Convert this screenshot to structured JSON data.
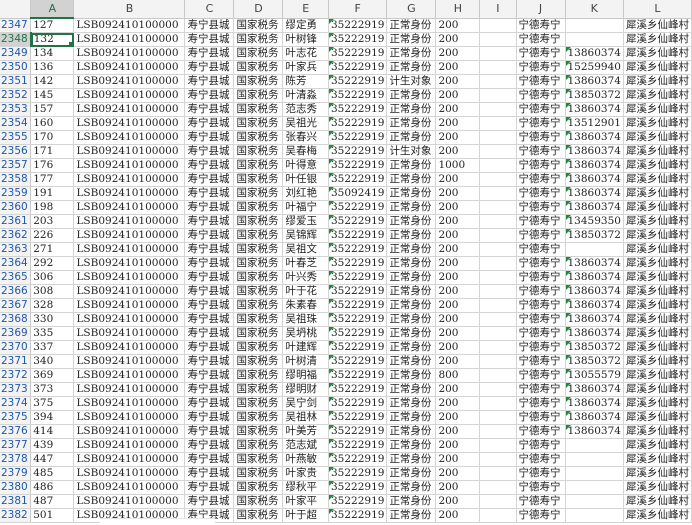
{
  "columns": [
    "A",
    "B",
    "C",
    "D",
    "E",
    "F",
    "G",
    "H",
    "I",
    "J",
    "K",
    "L"
  ],
  "selected_column": "A",
  "selected_row": "2348",
  "rows": [
    {
      "n": "2347",
      "cells": [
        "127",
        "LSB092410100000",
        "寿宁县城",
        "国家税务",
        "缪定勇",
        "35222919",
        "正常身份",
        "200",
        "",
        "宁德寿宁",
        "",
        "犀溪乡仙峰村"
      ]
    },
    {
      "n": "2348",
      "cells": [
        "132",
        "LSB092410100000",
        "寿宁县城",
        "国家税务",
        "叶树锋",
        "35222919",
        "正常身份",
        "200",
        "",
        "宁德寿宁",
        "",
        "犀溪乡仙峰村"
      ]
    },
    {
      "n": "2349",
      "cells": [
        "134",
        "LSB092410100000",
        "寿宁县城",
        "国家税务",
        "叶志花",
        "35222919",
        "正常身份",
        "200",
        "",
        "宁德寿宁",
        "13860374",
        "犀溪乡仙峰村"
      ]
    },
    {
      "n": "2350",
      "cells": [
        "136",
        "LSB092410100000",
        "寿宁县城",
        "国家税务",
        "叶家兵",
        "35222919",
        "正常身份",
        "200",
        "",
        "宁德寿宁",
        "15259940",
        "犀溪乡仙峰村"
      ]
    },
    {
      "n": "2351",
      "cells": [
        "142",
        "LSB092410100000",
        "寿宁县城",
        "国家税务",
        "陈芳",
        "35222919",
        "计生对象",
        "200",
        "",
        "宁德寿宁",
        "13860374",
        "犀溪乡仙峰村"
      ]
    },
    {
      "n": "2352",
      "cells": [
        "145",
        "LSB092410100000",
        "寿宁县城",
        "国家税务",
        "叶清淼",
        "35222919",
        "正常身份",
        "200",
        "",
        "宁德寿宁",
        "13850372",
        "犀溪乡仙峰村"
      ]
    },
    {
      "n": "2353",
      "cells": [
        "157",
        "LSB092410100000",
        "寿宁县城",
        "国家税务",
        "范志秀",
        "35222919",
        "正常身份",
        "200",
        "",
        "宁德寿宁",
        "13860374",
        "犀溪乡仙峰村"
      ]
    },
    {
      "n": "2354",
      "cells": [
        "160",
        "LSB092410100000",
        "寿宁县城",
        "国家税务",
        "吴祖光",
        "35222919",
        "正常身份",
        "200",
        "",
        "宁德寿宁",
        "13512901",
        "犀溪乡仙峰村"
      ]
    },
    {
      "n": "2355",
      "cells": [
        "170",
        "LSB092410100000",
        "寿宁县城",
        "国家税务",
        "张春兴",
        "35222919",
        "正常身份",
        "200",
        "",
        "宁德寿宁",
        "13860374",
        "犀溪乡仙峰村"
      ]
    },
    {
      "n": "2356",
      "cells": [
        "171",
        "LSB092410100000",
        "寿宁县城",
        "国家税务",
        "吴春梅",
        "35222919",
        "计生对象",
        "200",
        "",
        "宁德寿宁",
        "13860374",
        "犀溪乡仙峰村"
      ]
    },
    {
      "n": "2357",
      "cells": [
        "176",
        "LSB092410100000",
        "寿宁县城",
        "国家税务",
        "叶得意",
        "35222919",
        "正常身份",
        "1000",
        "",
        "宁德寿宁",
        "13860374",
        "犀溪乡仙峰村"
      ]
    },
    {
      "n": "2358",
      "cells": [
        "177",
        "LSB092410100000",
        "寿宁县城",
        "国家税务",
        "叶任银",
        "35222919",
        "正常身份",
        "200",
        "",
        "宁德寿宁",
        "13860374",
        "犀溪乡仙峰村"
      ]
    },
    {
      "n": "2359",
      "cells": [
        "191",
        "LSB092410100000",
        "寿宁县城",
        "国家税务",
        "刘红艳",
        "35092419",
        "正常身份",
        "200",
        "",
        "宁德寿宁",
        "13860374",
        "犀溪乡仙峰村"
      ]
    },
    {
      "n": "2360",
      "cells": [
        "198",
        "LSB092410100000",
        "寿宁县城",
        "国家税务",
        "叶福宁",
        "35222919",
        "正常身份",
        "200",
        "",
        "宁德寿宁",
        "13860374",
        "犀溪乡仙峰村"
      ]
    },
    {
      "n": "2361",
      "cells": [
        "203",
        "LSB092410100000",
        "寿宁县城",
        "国家税务",
        "缪爱玉",
        "35222919",
        "正常身份",
        "200",
        "",
        "宁德寿宁",
        "13459350",
        "犀溪乡仙峰村"
      ]
    },
    {
      "n": "2362",
      "cells": [
        "226",
        "LSB092410100000",
        "寿宁县城",
        "国家税务",
        "吴锦辉",
        "35222919",
        "正常身份",
        "200",
        "",
        "宁德寿宁",
        "13850372",
        "犀溪乡仙峰村"
      ]
    },
    {
      "n": "2363",
      "cells": [
        "271",
        "LSB092410100000",
        "寿宁县城",
        "国家税务",
        "吴祖文",
        "35222919",
        "正常身份",
        "200",
        "",
        "宁德寿宁",
        "",
        "犀溪乡仙峰村"
      ]
    },
    {
      "n": "2364",
      "cells": [
        "292",
        "LSB092410100000",
        "寿宁县城",
        "国家税务",
        "叶春芝",
        "35222919",
        "正常身份",
        "200",
        "",
        "宁德寿宁",
        "13860374",
        "犀溪乡仙峰村"
      ]
    },
    {
      "n": "2365",
      "cells": [
        "306",
        "LSB092410100000",
        "寿宁县城",
        "国家税务",
        "叶兴秀",
        "35222919",
        "正常身份",
        "200",
        "",
        "宁德寿宁",
        "13860374",
        "犀溪乡仙峰村"
      ]
    },
    {
      "n": "2366",
      "cells": [
        "308",
        "LSB092410100000",
        "寿宁县城",
        "国家税务",
        "叶于花",
        "35222919",
        "正常身份",
        "200",
        "",
        "宁德寿宁",
        "13860374",
        "犀溪乡仙峰村"
      ]
    },
    {
      "n": "2367",
      "cells": [
        "328",
        "LSB092410100000",
        "寿宁县城",
        "国家税务",
        "朱素春",
        "35222919",
        "正常身份",
        "200",
        "",
        "宁德寿宁",
        "13860374",
        "犀溪乡仙峰村"
      ]
    },
    {
      "n": "2368",
      "cells": [
        "330",
        "LSB092410100000",
        "寿宁县城",
        "国家税务",
        "吴祖珠",
        "35222919",
        "正常身份",
        "200",
        "",
        "宁德寿宁",
        "13860374",
        "犀溪乡仙峰村"
      ]
    },
    {
      "n": "2369",
      "cells": [
        "335",
        "LSB092410100000",
        "寿宁县城",
        "国家税务",
        "吴坍桃",
        "35222919",
        "正常身份",
        "200",
        "",
        "宁德寿宁",
        "13860374",
        "犀溪乡仙峰村"
      ]
    },
    {
      "n": "2370",
      "cells": [
        "337",
        "LSB092410100000",
        "寿宁县城",
        "国家税务",
        "叶建辉",
        "35222919",
        "正常身份",
        "200",
        "",
        "宁德寿宁",
        "13850372",
        "犀溪乡仙峰村"
      ]
    },
    {
      "n": "2371",
      "cells": [
        "340",
        "LSB092410100000",
        "寿宁县城",
        "国家税务",
        "叶树清",
        "35222919",
        "正常身份",
        "200",
        "",
        "宁德寿宁",
        "13850372",
        "犀溪乡仙峰村"
      ]
    },
    {
      "n": "2372",
      "cells": [
        "369",
        "LSB092410100000",
        "寿宁县城",
        "国家税务",
        "缪明福",
        "35222919",
        "正常身份",
        "800",
        "",
        "宁德寿宁",
        "13055579",
        "犀溪乡仙峰村"
      ]
    },
    {
      "n": "2373",
      "cells": [
        "373",
        "LSB092410100000",
        "寿宁县城",
        "国家税务",
        "缪明财",
        "35222919",
        "正常身份",
        "200",
        "",
        "宁德寿宁",
        "13860374",
        "犀溪乡仙峰村"
      ]
    },
    {
      "n": "2374",
      "cells": [
        "375",
        "LSB092410100000",
        "寿宁县城",
        "国家税务",
        "吴宁剑",
        "35222919",
        "正常身份",
        "200",
        "",
        "宁德寿宁",
        "13860374",
        "犀溪乡仙峰村"
      ]
    },
    {
      "n": "2375",
      "cells": [
        "394",
        "LSB092410100000",
        "寿宁县城",
        "国家税务",
        "吴祖林",
        "35222919",
        "正常身份",
        "200",
        "",
        "宁德寿宁",
        "13860374",
        "犀溪乡仙峰村"
      ]
    },
    {
      "n": "2376",
      "cells": [
        "414",
        "LSB092410100000",
        "寿宁县城",
        "国家税务",
        "叶美芳",
        "35222919",
        "正常身份",
        "200",
        "",
        "宁德寿宁",
        "13860374",
        "犀溪乡仙峰村"
      ]
    },
    {
      "n": "2377",
      "cells": [
        "439",
        "LSB092410100000",
        "寿宁县城",
        "国家税务",
        "范志斌",
        "35222919",
        "正常身份",
        "200",
        "",
        "宁德寿宁",
        "",
        "犀溪乡仙峰村"
      ]
    },
    {
      "n": "2378",
      "cells": [
        "447",
        "LSB092410100000",
        "寿宁县城",
        "国家税务",
        "叶燕敏",
        "35222919",
        "正常身份",
        "200",
        "",
        "宁德寿宁",
        "",
        "犀溪乡仙峰村"
      ]
    },
    {
      "n": "2379",
      "cells": [
        "485",
        "LSB092410100000",
        "寿宁县城",
        "国家税务",
        "叶家贵",
        "35222919",
        "正常身份",
        "200",
        "",
        "宁德寿宁",
        "",
        "犀溪乡仙峰村"
      ]
    },
    {
      "n": "2380",
      "cells": [
        "486",
        "LSB092410100000",
        "寿宁县城",
        "国家税务",
        "缪秋平",
        "35222919",
        "正常身份",
        "200",
        "",
        "宁德寿宁",
        "",
        "犀溪乡仙峰村"
      ]
    },
    {
      "n": "2381",
      "cells": [
        "487",
        "LSB092410100000",
        "寿宁县城",
        "国家税务",
        "叶家平",
        "35222919",
        "正常身份",
        "200",
        "",
        "宁德寿宁",
        "",
        "犀溪乡仙峰村"
      ]
    },
    {
      "n": "2382",
      "cells": [
        "501",
        "LSB092410100000",
        "寿宁县城",
        "国家税务",
        "叶于超",
        "35222919",
        "正常身份",
        "200",
        "",
        "宁德寿宁",
        "",
        "犀溪乡仙峰村"
      ]
    }
  ]
}
